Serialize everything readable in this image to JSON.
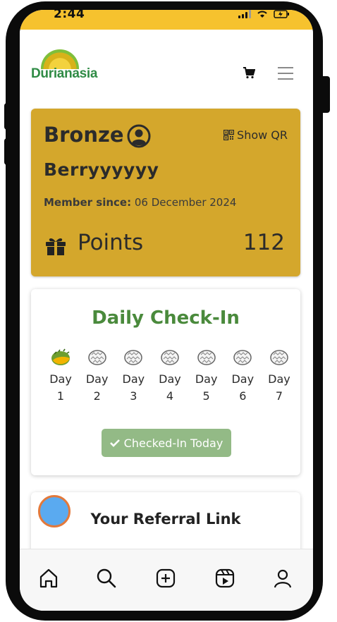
{
  "status_bar": {
    "time": "2:44"
  },
  "header": {
    "logo_text": "Durianasia"
  },
  "member_card": {
    "tier": "Bronze",
    "show_qr_label": "Show QR",
    "username": "Berryyyyyy",
    "member_since_label": "Member since:",
    "member_since_value": "06 December 2024",
    "points_label": "Points",
    "points_value": "112",
    "card_color": "#d4a72c"
  },
  "daily_checkin": {
    "title": "Daily Check-In",
    "days": [
      {
        "label": "Day",
        "num": "1",
        "checked": true
      },
      {
        "label": "Day",
        "num": "2",
        "checked": false
      },
      {
        "label": "Day",
        "num": "3",
        "checked": false
      },
      {
        "label": "Day",
        "num": "4",
        "checked": false
      },
      {
        "label": "Day",
        "num": "5",
        "checked": false
      },
      {
        "label": "Day",
        "num": "6",
        "checked": false
      },
      {
        "label": "Day",
        "num": "7",
        "checked": false
      }
    ],
    "button_label": "Checked-In Today",
    "title_color": "#4a8a3c"
  },
  "referral": {
    "title": "Your Referral Link"
  },
  "tab_bar": {
    "items": [
      "home-icon",
      "search-icon",
      "add-icon",
      "reels-icon",
      "profile-icon"
    ]
  },
  "colors": {
    "status_bar": "#f6c22e",
    "brand_green": "#2f8b45",
    "button_green": "#93ba86"
  }
}
